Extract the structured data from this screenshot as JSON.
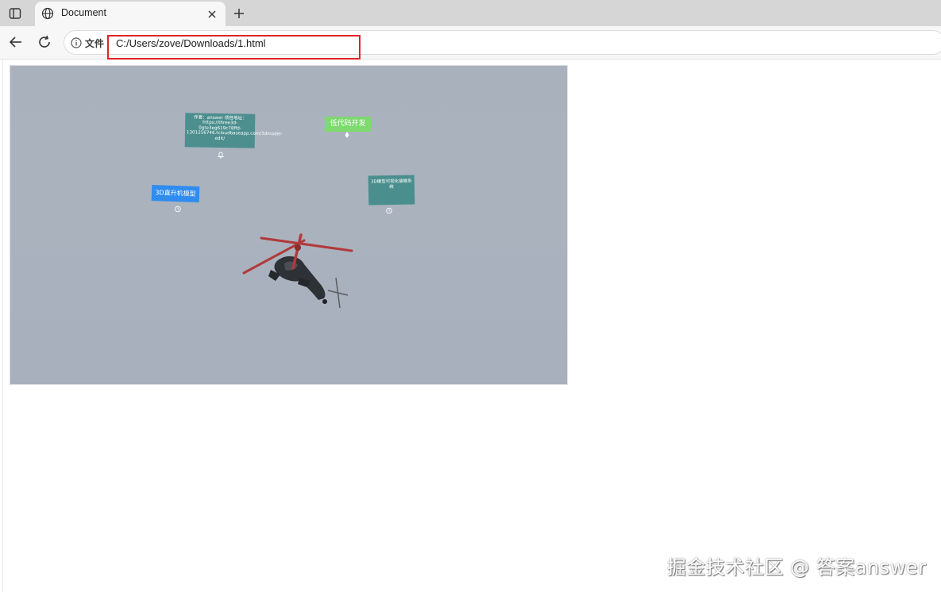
{
  "browser": {
    "tab": {
      "title": "Document"
    },
    "address_bar": {
      "site_info_label": "文件",
      "url": "C:/Users/zove/Downloads/1.html"
    }
  },
  "scene": {
    "labels": {
      "author": "作者：answer 项目地址：https://three3d-0gte3eg619c78ffd-1301256746.tcloudbaseapp.com/3dmodel-edit/",
      "low_code": "低代码开发",
      "model": "3D直升机模型",
      "editor": "3D模型可视化编辑系统"
    }
  },
  "watermark": "掘金技术社区 @ 答案answer",
  "colors": {
    "author_card": "#4d8f8f",
    "low_code_card": "#7ed96f",
    "model_card": "#2f8cf0",
    "editor_card": "#4a8f8e",
    "rotor": "#b03a3a",
    "url_highlight": "#e02424"
  }
}
